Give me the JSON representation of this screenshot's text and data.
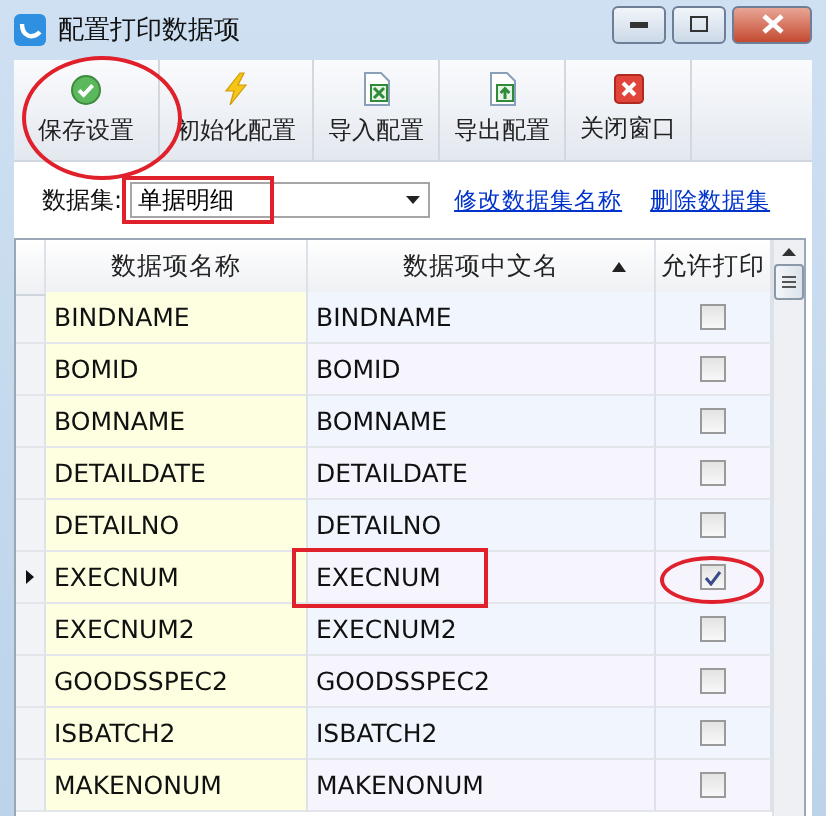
{
  "window": {
    "title": "配置打印数据项"
  },
  "toolbar": [
    {
      "label": "保存设置",
      "annotated": true
    },
    {
      "label": "初始化配置",
      "annotated": false
    },
    {
      "label": "导入配置",
      "annotated": false
    },
    {
      "label": "导出配置",
      "annotated": false
    },
    {
      "label": "关闭窗口",
      "annotated": false
    }
  ],
  "dataset": {
    "label": "数据集:",
    "value": "单据明细",
    "annotated": true,
    "links": [
      "修改数据集名称",
      "删除数据集"
    ]
  },
  "table": {
    "columns": [
      {
        "label": "数据项名称",
        "sorted": false
      },
      {
        "label": "数据项中文名",
        "sorted": true
      },
      {
        "label": "允许打印",
        "sorted": false
      }
    ],
    "rows": [
      {
        "name": "BINDNAME",
        "cn": "BINDNAME",
        "print": false,
        "selected": false
      },
      {
        "name": "BOMID",
        "cn": "BOMID",
        "print": false,
        "selected": false
      },
      {
        "name": "BOMNAME",
        "cn": "BOMNAME",
        "print": false,
        "selected": false
      },
      {
        "name": "DETAILDATE",
        "cn": "DETAILDATE",
        "print": false,
        "selected": false
      },
      {
        "name": "DETAILNO",
        "cn": "DETAILNO",
        "print": false,
        "selected": false
      },
      {
        "name": "EXECNUM",
        "cn": "EXECNUM",
        "print": true,
        "selected": true,
        "annotated": true
      },
      {
        "name": "EXECNUM2",
        "cn": "EXECNUM2",
        "print": false,
        "selected": false
      },
      {
        "name": "GOODSSPEC2",
        "cn": "GOODSSPEC2",
        "print": false,
        "selected": false
      },
      {
        "name": "ISBATCH2",
        "cn": "ISBATCH2",
        "print": false,
        "selected": false
      },
      {
        "name": "MAKENONUM",
        "cn": "MAKENONUM",
        "print": false,
        "selected": false
      }
    ]
  }
}
